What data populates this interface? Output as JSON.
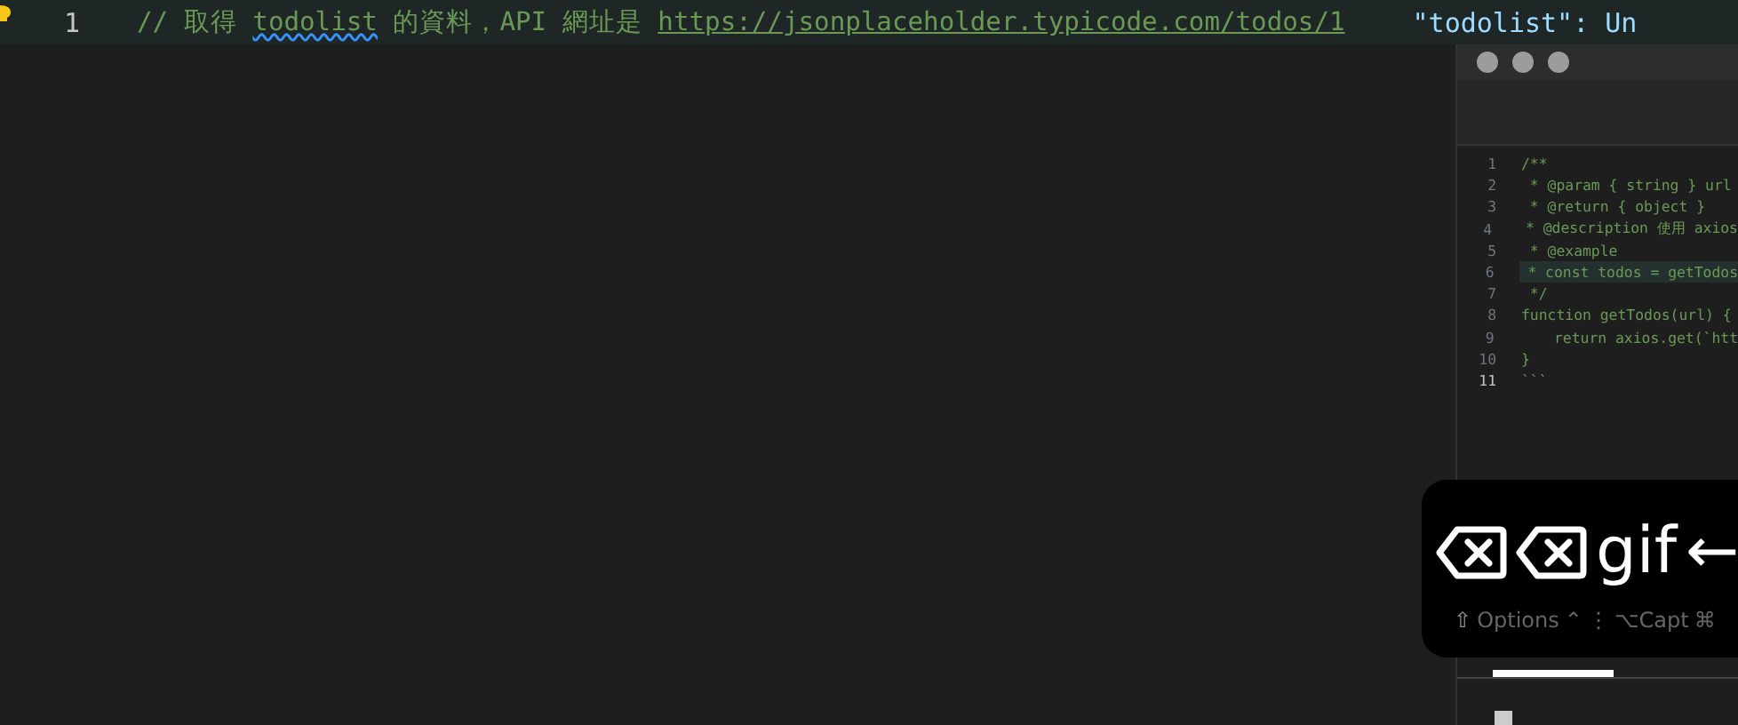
{
  "editor": {
    "line_number": "1",
    "comment_segments": [
      {
        "kind": "plain",
        "text": "// 取得 "
      },
      {
        "kind": "squiggle",
        "text": "todolist"
      },
      {
        "kind": "plain",
        "text": " 的資料，API 網址是 "
      },
      {
        "kind": "link",
        "text": "https://jsonplaceholder.typicode.com/todos/1"
      }
    ],
    "ghost_text": "\"todolist\": Un"
  },
  "preview_window": {
    "lines": [
      {
        "number": "1",
        "text": "/**",
        "current": false,
        "highlighted": false
      },
      {
        "number": "2",
        "text": " * @param { string } url",
        "current": false,
        "highlighted": false
      },
      {
        "number": "3",
        "text": " * @return { object }",
        "current": false,
        "highlighted": false
      },
      {
        "number": "4",
        "text": " * @description 使用 axios",
        "current": false,
        "highlighted": false
      },
      {
        "number": "5",
        "text": " * @example",
        "current": false,
        "highlighted": false
      },
      {
        "number": "6",
        "text": " * const todos = getTodos",
        "current": false,
        "highlighted": true
      },
      {
        "number": "7",
        "text": " */",
        "current": false,
        "highlighted": false
      },
      {
        "number": "8",
        "text": "function getTodos(url) {",
        "current": false,
        "highlighted": false
      },
      {
        "number": "9",
        "text": "    return axios.get(`htt",
        "current": false,
        "highlighted": false
      },
      {
        "number": "10",
        "text": "}",
        "current": false,
        "highlighted": false
      },
      {
        "number": "11",
        "text": "```",
        "current": true,
        "highlighted": false
      }
    ]
  },
  "keystroke_overlay": {
    "keys": [
      {
        "kind": "icon"
      },
      {
        "kind": "icon"
      },
      {
        "kind": "text",
        "text": "gif"
      },
      {
        "kind": "text",
        "text": "←"
      }
    ],
    "modifiers": [
      "⇧",
      "Options",
      "⌃",
      "⋮",
      "⌥Capt",
      "⌘"
    ]
  }
}
